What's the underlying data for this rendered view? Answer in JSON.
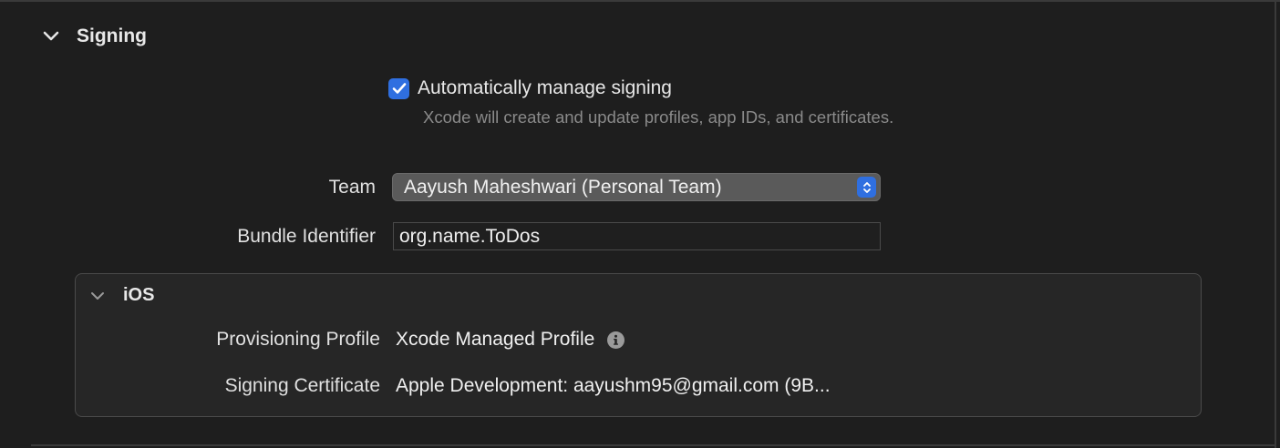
{
  "signing": {
    "title": "Signing",
    "auto_manage_label": "Automatically manage signing",
    "auto_manage_checked": true,
    "auto_manage_help": "Xcode will create and update profiles, app IDs, and certificates.",
    "team_label": "Team",
    "team_value": "Aayush Maheshwari (Personal Team)",
    "bundle_label": "Bundle Identifier",
    "bundle_value": "org.name.ToDos"
  },
  "ios": {
    "title": "iOS",
    "provisioning_label": "Provisioning Profile",
    "provisioning_value": "Xcode Managed Profile",
    "certificate_label": "Signing Certificate",
    "certificate_value": "Apple Development: aayushm95@gmail.com (9B..."
  },
  "colors": {
    "accent": "#2f6fe0",
    "background": "#1e1e1e",
    "secondary_text": "#8a8a8a"
  },
  "icons": {
    "section_chevron": "chevron-down-icon",
    "checkbox_check": "checkmark-icon",
    "popup_stepper": "up-down-chevron-icon",
    "info": "info-icon"
  }
}
